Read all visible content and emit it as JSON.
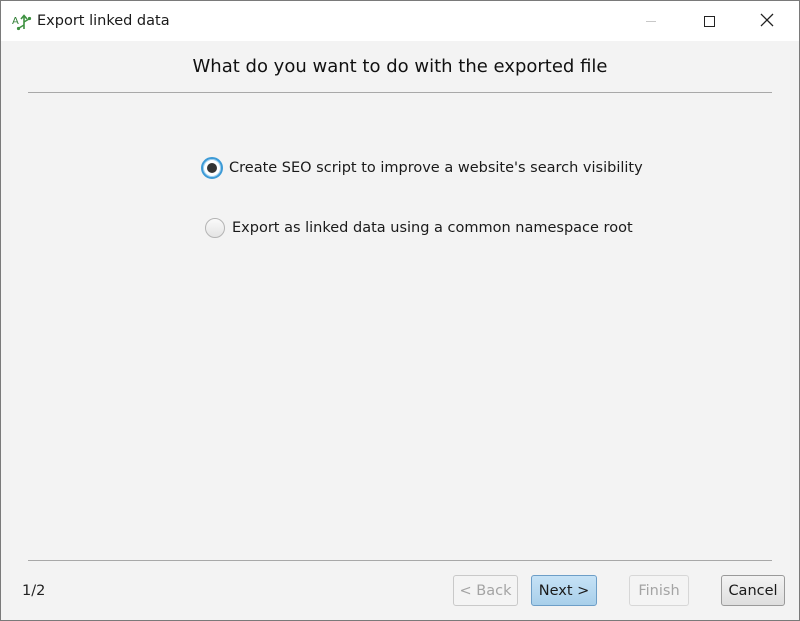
{
  "window": {
    "title": "Export linked data",
    "icon": "linked-data-icon",
    "controls": {
      "minimize": "minimize-icon",
      "maximize": "maximize-icon",
      "close": "close-icon"
    }
  },
  "wizard": {
    "heading": "What do you want to do with the exported file",
    "options": [
      {
        "label": "Create SEO script to improve a website's search visibility",
        "selected": true
      },
      {
        "label": "Export as linked data using a common namespace root",
        "selected": false
      }
    ],
    "page_indicator": "1/2"
  },
  "buttons": {
    "back": {
      "label": "< Back",
      "enabled": false
    },
    "next": {
      "label": "Next >",
      "enabled": true,
      "default": true
    },
    "finish": {
      "label": "Finish",
      "enabled": false
    },
    "cancel": {
      "label": "Cancel",
      "enabled": true
    }
  },
  "colors": {
    "accent": "#3c9ad6",
    "default_button": "#a8cfea",
    "icon_green": "#3d9140",
    "window_bg": "#f3f3f3"
  }
}
